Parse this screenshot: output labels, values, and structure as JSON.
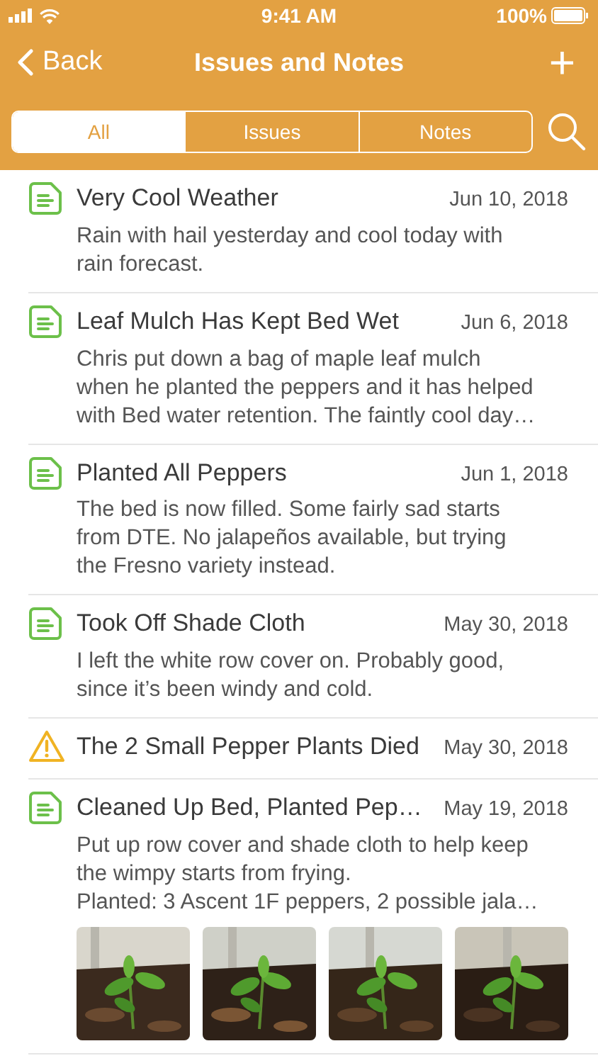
{
  "status_bar": {
    "time": "9:41 AM",
    "battery": "100%"
  },
  "nav": {
    "back": "Back",
    "title": "Issues and Notes",
    "add": "+"
  },
  "tabs": [
    {
      "label": "All",
      "selected": true
    },
    {
      "label": "Issues",
      "selected": false
    },
    {
      "label": "Notes",
      "selected": false
    }
  ],
  "entries": [
    {
      "kind": "note",
      "title": "Very Cool Weather",
      "date": "Jun 10, 2018",
      "lines": [
        "Rain with hail yesterday and cool today with",
        "rain forecast."
      ]
    },
    {
      "kind": "note",
      "title": "Leaf Mulch Has Kept Bed Wet",
      "date": "Jun 6, 2018",
      "lines": [
        "Chris put down a bag of maple leaf mulch",
        "when he planted the peppers and it has helped",
        "with Bed water retention. The faintly cool day…"
      ]
    },
    {
      "kind": "note",
      "title": "Planted All Peppers",
      "date": "Jun 1, 2018",
      "lines": [
        "The bed is now filled. Some fairly sad starts",
        "from DTE. No jalapeños available, but trying",
        "the Fresno variety instead."
      ]
    },
    {
      "kind": "note",
      "title": "Took Off Shade Cloth",
      "date": "May 30, 2018",
      "lines": [
        "I left the white row cover on. Probably good,",
        "since it’s been windy and cold."
      ]
    },
    {
      "kind": "issue",
      "title": "The 2 Small Pepper Plants Died",
      "date": "May 30, 2018"
    },
    {
      "kind": "note",
      "title": "Cleaned Up Bed, Planted Pep…",
      "date": "May 19, 2018",
      "lines": [
        "Put up row cover and shade cloth to help keep",
        "the wimpy starts from frying.",
        "Planted: 3 Ascent 1F peppers, 2 possible jala…"
      ],
      "photos": [
        {
          "kind": "picture"
        },
        {
          "kind": "picture"
        },
        {
          "kind": "picture"
        },
        {
          "kind": "picture"
        }
      ]
    }
  ]
}
